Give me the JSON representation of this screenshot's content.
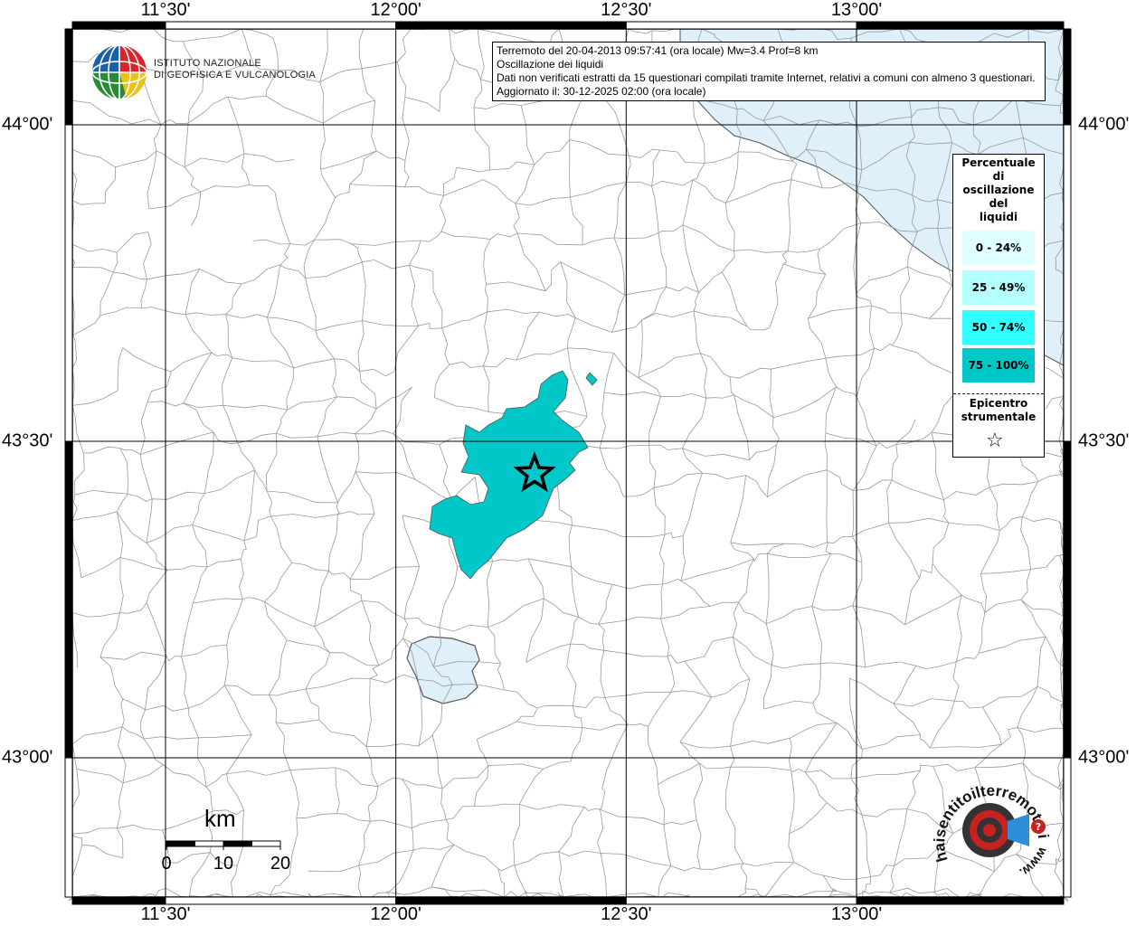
{
  "map": {
    "lon_labels": [
      "11°30'",
      "12°00'",
      "12°30'",
      "13°00'"
    ],
    "lat_labels": [
      "44°00'",
      "43°30'",
      "43°00'"
    ],
    "lon_values": [
      11.5,
      12.0,
      12.5,
      13.0
    ],
    "lat_values": [
      44.0,
      43.5,
      43.0
    ],
    "water_color": "#dff0fb",
    "felt_area_color": "#00c8c8"
  },
  "info": {
    "line1": "Terremoto del 20-04-2013 09:57:41 (ora locale) Mw=3.4 Prof=8 km",
    "line2": "Oscillazione dei liquidi",
    "line3": "Dati non verificati estratti da 15 questionari compilati tramite Internet, relativi a comuni con almeno 3 questionari.",
    "line4": "Aggiornato il: 30-12-2025 02:00 (ora locale)"
  },
  "legend": {
    "title_lines": [
      "Percentuale",
      "di",
      "oscillazione",
      "del",
      "liquidi"
    ],
    "classes": [
      {
        "label": "0 - 24%",
        "color": "#e0ffff"
      },
      {
        "label": "25 - 49%",
        "color": "#b4ffff"
      },
      {
        "label": "50 - 74%",
        "color": "#32ffff"
      },
      {
        "label": "75 - 100%",
        "color": "#00c8c8"
      }
    ],
    "epicenter_lines": [
      "Epicentro",
      "strumentale"
    ],
    "star_icon": "star-icon"
  },
  "logo": {
    "line1": "ISTITUTO NAZIONALE",
    "line2": "DI GEOFISICA E VULCANOLOGIA"
  },
  "scale": {
    "unit": "km",
    "ticks": [
      "0",
      "10",
      "20"
    ]
  },
  "hst": {
    "text": "haisentitoilterremoto.it",
    "url": "www."
  }
}
